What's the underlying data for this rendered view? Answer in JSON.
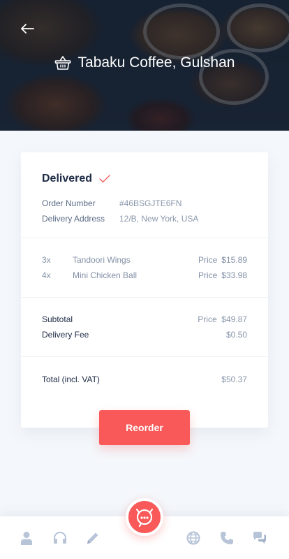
{
  "header": {
    "restaurant_name": "Tabaku Coffee, Gulshan"
  },
  "order": {
    "status": "Delivered",
    "order_number_label": "Order Number",
    "order_number": "#46BSGJTE6FN",
    "address_label": "Delivery Address",
    "address": "12/B, New York, USA",
    "items": [
      {
        "qty": "3x",
        "name": "Tandoori Wings",
        "price_label": "Price",
        "price": "$15.89"
      },
      {
        "qty": "4x",
        "name": "Mini Chicken Ball",
        "price_label": "Price",
        "price": "$33.98"
      }
    ],
    "subtotal_label": "Subtotal",
    "subtotal_price_label": "Price",
    "subtotal": "$49.87",
    "delivery_fee_label": "Delivery Fee",
    "delivery_fee": "$0.50",
    "total_label": "Total (incl. VAT)",
    "total": "$50.37"
  },
  "actions": {
    "reorder_label": "Reorder"
  },
  "nav": {
    "icons": [
      "user-icon",
      "headphones-icon",
      "pencil-icon",
      "support-chat-icon",
      "globe-icon",
      "phone-icon",
      "chat-bubbles-icon"
    ]
  },
  "colors": {
    "accent": "#f95959",
    "dark_text": "#1d2a44",
    "muted_text": "#8a97ab",
    "icon_blue": "#b7c4d8"
  }
}
